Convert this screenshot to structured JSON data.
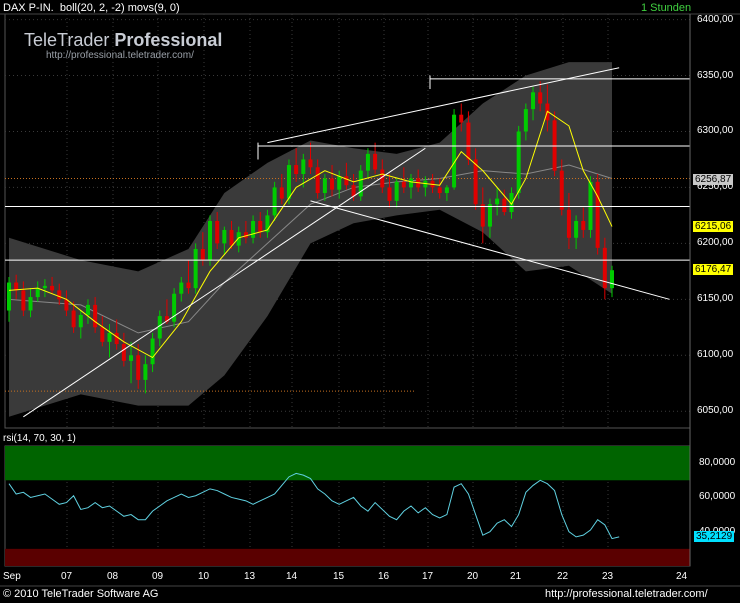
{
  "window": {
    "title": "DAX P-IN.",
    "params": "boll(20, 2, -2) movs(9, 0)",
    "interval": "1 Stunden"
  },
  "logo": {
    "brand": "TeleTrader",
    "product": "Professional",
    "url": "http://professional.teletrader.com/"
  },
  "price_axis": {
    "ticks": [
      "6400,00",
      "6350,00",
      "6300,00",
      "6250,00",
      "6200,00",
      "6150,00",
      "6100,00",
      "6050,00"
    ]
  },
  "price_markers": [
    {
      "label": "6256,87",
      "bg": "#c8c8c8"
    },
    {
      "label": "6215,06",
      "bg": "#ffff00"
    },
    {
      "label": "6176,47",
      "bg": "#ffff00"
    }
  ],
  "rsi": {
    "title": "rsi(14, 70, 30, 1)",
    "ticks": [
      "80,0000",
      "60,0000",
      "40,0000"
    ],
    "value": "35,2129"
  },
  "x_axis": {
    "labels": [
      "Sep",
      "07",
      "08",
      "09",
      "10",
      "13",
      "14",
      "15",
      "16",
      "17",
      "20",
      "21",
      "22",
      "23",
      "24"
    ]
  },
  "footer": {
    "copyright": "© 2010 TeleTrader Software AG",
    "url": "http://professional.teletrader.com/"
  },
  "colors": {
    "up": "#00cc00",
    "down": "#e00000",
    "band": "#3a3a3a",
    "ma": "#ffff00",
    "rsi": "#5fd0e0",
    "ob": "#006400",
    "os": "#5a0000"
  },
  "chart_data": {
    "type": "candlestick",
    "price_axis_range": [
      6035,
      6405
    ],
    "candles": [
      [
        6140,
        6170,
        6130,
        6165
      ],
      [
        6165,
        6172,
        6150,
        6158
      ],
      [
        6158,
        6166,
        6135,
        6140
      ],
      [
        6140,
        6160,
        6134,
        6152
      ],
      [
        6152,
        6166,
        6148,
        6160
      ],
      [
        6160,
        6168,
        6152,
        6162
      ],
      [
        6162,
        6170,
        6155,
        6158
      ],
      [
        6158,
        6164,
        6145,
        6150
      ],
      [
        6150,
        6158,
        6135,
        6140
      ],
      [
        6140,
        6148,
        6120,
        6125
      ],
      [
        6125,
        6140,
        6115,
        6136
      ],
      [
        6136,
        6150,
        6128,
        6145
      ],
      [
        6145,
        6152,
        6120,
        6125
      ],
      [
        6125,
        6135,
        6108,
        6112
      ],
      [
        6112,
        6128,
        6098,
        6120
      ],
      [
        6120,
        6132,
        6105,
        6110
      ],
      [
        6110,
        6120,
        6090,
        6095
      ],
      [
        6095,
        6112,
        6075,
        6100
      ],
      [
        6100,
        6110,
        6070,
        6078
      ],
      [
        6078,
        6100,
        6066,
        6092
      ],
      [
        6092,
        6120,
        6085,
        6115
      ],
      [
        6115,
        6140,
        6108,
        6135
      ],
      [
        6135,
        6150,
        6128,
        6130
      ],
      [
        6130,
        6160,
        6125,
        6155
      ],
      [
        6155,
        6170,
        6148,
        6165
      ],
      [
        6165,
        6185,
        6155,
        6160
      ],
      [
        6160,
        6200,
        6155,
        6195
      ],
      [
        6195,
        6210,
        6180,
        6185
      ],
      [
        6185,
        6225,
        6180,
        6220
      ],
      [
        6220,
        6228,
        6195,
        6200
      ],
      [
        6200,
        6215,
        6190,
        6212
      ],
      [
        6212,
        6220,
        6195,
        6198
      ],
      [
        6198,
        6215,
        6192,
        6210
      ],
      [
        6210,
        6220,
        6200,
        6205
      ],
      [
        6205,
        6225,
        6200,
        6220
      ],
      [
        6220,
        6228,
        6205,
        6210
      ],
      [
        6210,
        6230,
        6205,
        6225
      ],
      [
        6225,
        6255,
        6220,
        6250
      ],
      [
        6250,
        6262,
        6235,
        6240
      ],
      [
        6240,
        6275,
        6235,
        6270
      ],
      [
        6270,
        6285,
        6255,
        6262
      ],
      [
        6262,
        6280,
        6250,
        6275
      ],
      [
        6275,
        6290,
        6262,
        6268
      ],
      [
        6268,
        6275,
        6240,
        6245
      ],
      [
        6245,
        6262,
        6238,
        6258
      ],
      [
        6258,
        6270,
        6242,
        6248
      ],
      [
        6248,
        6265,
        6240,
        6260
      ],
      [
        6260,
        6272,
        6248,
        6252
      ],
      [
        6252,
        6262,
        6238,
        6242
      ],
      [
        6242,
        6270,
        6238,
        6265
      ],
      [
        6265,
        6285,
        6258,
        6280
      ],
      [
        6280,
        6290,
        6262,
        6266
      ],
      [
        6266,
        6275,
        6245,
        6250
      ],
      [
        6250,
        6262,
        6232,
        6238
      ],
      [
        6238,
        6258,
        6232,
        6255
      ],
      [
        6255,
        6268,
        6245,
        6250
      ],
      [
        6250,
        6262,
        6240,
        6258
      ],
      [
        6258,
        6266,
        6246,
        6250
      ],
      [
        6250,
        6260,
        6242,
        6256
      ],
      [
        6256,
        6262,
        6245,
        6250
      ],
      [
        6250,
        6258,
        6240,
        6245
      ],
      [
        6245,
        6252,
        6238,
        6250
      ],
      [
        6250,
        6320,
        6248,
        6315
      ],
      [
        6315,
        6325,
        6300,
        6308
      ],
      [
        6308,
        6318,
        6270,
        6275
      ],
      [
        6275,
        6285,
        6230,
        6235
      ],
      [
        6235,
        6250,
        6200,
        6215
      ],
      [
        6215,
        6240,
        6205,
        6235
      ],
      [
        6235,
        6250,
        6225,
        6240
      ],
      [
        6240,
        6248,
        6225,
        6228
      ],
      [
        6228,
        6250,
        6222,
        6245
      ],
      [
        6245,
        6305,
        6240,
        6300
      ],
      [
        6300,
        6325,
        6292,
        6320
      ],
      [
        6320,
        6340,
        6310,
        6335
      ],
      [
        6335,
        6345,
        6318,
        6325
      ],
      [
        6325,
        6342,
        6300,
        6310
      ],
      [
        6310,
        6318,
        6260,
        6265
      ],
      [
        6265,
        6275,
        6225,
        6230
      ],
      [
        6230,
        6245,
        6195,
        6205
      ],
      [
        6205,
        6225,
        6195,
        6220
      ],
      [
        6220,
        6232,
        6205,
        6212
      ],
      [
        6212,
        6260,
        6205,
        6255
      ],
      [
        6255,
        6262,
        6190,
        6196
      ],
      [
        6196,
        6205,
        6150,
        6160
      ],
      [
        6160,
        6180,
        6152,
        6176
      ]
    ],
    "bollinger": {
      "upper": [
        [
          0,
          6205
        ],
        [
          10,
          6185
        ],
        [
          18,
          6175
        ],
        [
          25,
          6195
        ],
        [
          30,
          6245
        ],
        [
          36,
          6272
        ],
        [
          42,
          6292
        ],
        [
          48,
          6285
        ],
        [
          54,
          6280
        ],
        [
          60,
          6290
        ],
        [
          66,
          6325
        ],
        [
          72,
          6350
        ],
        [
          78,
          6362
        ],
        [
          84,
          6362
        ]
      ],
      "middle": [
        [
          0,
          6150
        ],
        [
          10,
          6145
        ],
        [
          18,
          6120
        ],
        [
          25,
          6130
        ],
        [
          30,
          6165
        ],
        [
          36,
          6200
        ],
        [
          42,
          6235
        ],
        [
          48,
          6250
        ],
        [
          54,
          6255
        ],
        [
          60,
          6258
        ],
        [
          66,
          6265
        ],
        [
          72,
          6262
        ],
        [
          78,
          6270
        ],
        [
          84,
          6258
        ]
      ],
      "lower": [
        [
          0,
          6045
        ],
        [
          10,
          6065
        ],
        [
          18,
          6055
        ],
        [
          25,
          6055
        ],
        [
          30,
          6082
        ],
        [
          36,
          6135
        ],
        [
          42,
          6200
        ],
        [
          48,
          6218
        ],
        [
          54,
          6225
        ],
        [
          60,
          6230
        ],
        [
          66,
          6210
        ],
        [
          72,
          6175
        ],
        [
          78,
          6180
        ],
        [
          84,
          6155
        ]
      ]
    },
    "moving_average": [
      [
        0,
        6158
      ],
      [
        4,
        6160
      ],
      [
        8,
        6150
      ],
      [
        12,
        6130
      ],
      [
        16,
        6112
      ],
      [
        20,
        6098
      ],
      [
        24,
        6130
      ],
      [
        28,
        6175
      ],
      [
        32,
        6205
      ],
      [
        36,
        6212
      ],
      [
        40,
        6250
      ],
      [
        44,
        6265
      ],
      [
        48,
        6255
      ],
      [
        52,
        6262
      ],
      [
        56,
        6255
      ],
      [
        60,
        6252
      ],
      [
        63,
        6282
      ],
      [
        66,
        6265
      ],
      [
        70,
        6235
      ],
      [
        72,
        6258
      ],
      [
        75,
        6318
      ],
      [
        78,
        6305
      ],
      [
        80,
        6265
      ],
      [
        82,
        6242
      ],
      [
        84,
        6215
      ]
    ],
    "horizontal_lines": [
      6347,
      6287,
      6233,
      6185
    ],
    "trend_lines": [
      [
        [
          2,
          6045
        ],
        [
          58,
          6285
        ]
      ],
      [
        [
          36,
          6290
        ],
        [
          85,
          6357
        ]
      ],
      [
        [
          42,
          6238
        ],
        [
          92,
          6150
        ]
      ]
    ],
    "rsi_series": [
      68,
      62,
      63,
      60,
      61,
      62,
      59,
      56,
      57,
      61,
      53,
      54,
      57,
      54,
      55,
      52,
      49,
      50,
      47,
      47,
      52,
      55,
      58,
      60,
      62,
      60,
      61,
      63,
      65,
      64,
      62,
      60,
      59,
      58,
      56,
      58,
      60,
      62,
      67,
      72,
      74,
      73,
      71,
      65,
      62,
      58,
      56,
      58,
      60,
      55,
      52,
      57,
      53,
      49,
      47,
      52,
      55,
      51,
      54,
      50,
      48,
      50,
      66,
      68,
      62,
      50,
      38,
      40,
      45,
      47,
      43,
      50,
      63,
      67,
      70,
      68,
      64,
      50,
      40,
      37,
      38,
      41,
      47,
      44,
      36,
      37
    ]
  }
}
